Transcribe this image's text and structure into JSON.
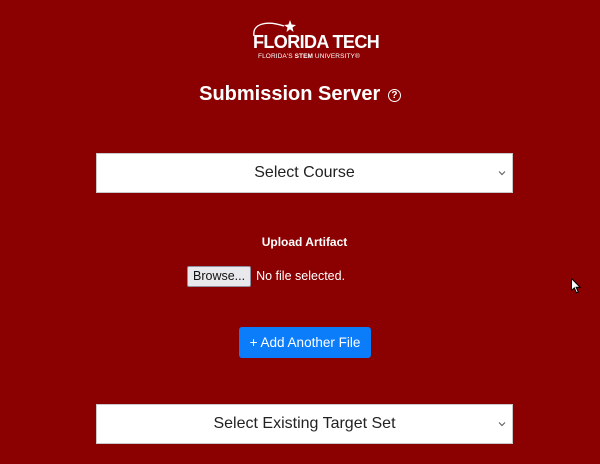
{
  "header": {
    "logo": {
      "name": "FLORIDA TECH",
      "tagline_prefix": "FLORIDA'S ",
      "tagline_bold": "STEM",
      "tagline_suffix": " UNIVERSITY",
      "trademark": "®"
    },
    "title": "Submission Server",
    "help_icon": "question-circle-icon",
    "help_glyph": "?"
  },
  "course_select": {
    "selected": "Select Course",
    "icon": "chevron-down-icon"
  },
  "upload": {
    "label": "Upload Artifact",
    "browse_label": "Browse...",
    "file_status": "No file selected."
  },
  "add_file_button": {
    "label": "+ Add Another File"
  },
  "target_set_select": {
    "selected": "Select Existing Target Set",
    "icon": "chevron-down-icon"
  },
  "colors": {
    "background": "#8b0000",
    "primary_button": "#0b7dfb",
    "text": "#ffffff"
  }
}
